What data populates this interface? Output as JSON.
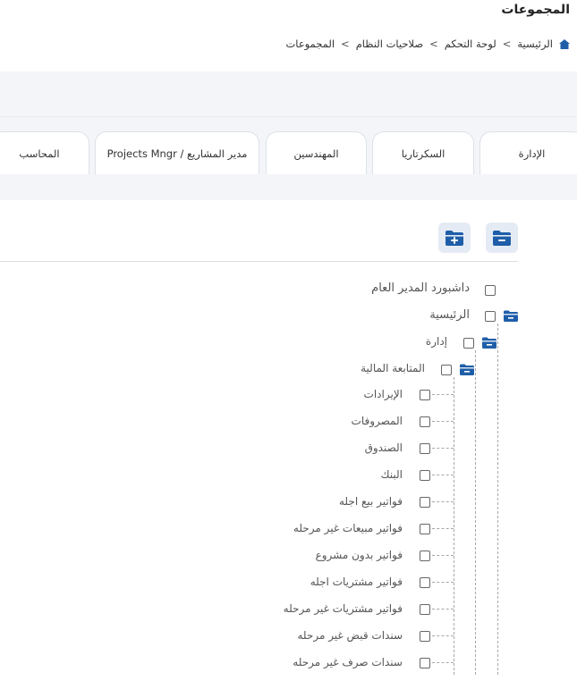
{
  "page": {
    "title": "المجموعات"
  },
  "breadcrumb": {
    "home_icon": "home-icon",
    "items": [
      "الرئيسية",
      "لوحة التحكم",
      "صلاحيات النظام",
      "المجموعات"
    ],
    "separator": ">"
  },
  "tabs": [
    {
      "label": "الإدارة"
    },
    {
      "label": "السكرتاريا"
    },
    {
      "label": "المهندسين"
    },
    {
      "label": "مدير المشاريع / Projects Mngr"
    },
    {
      "label": "المحاسب"
    }
  ],
  "toolbar": {
    "collapse_all_icon": "folder-minus-icon",
    "expand_all_icon": "folder-plus-icon"
  },
  "tree": {
    "root": [
      {
        "label": "داشبورد المدير العام"
      },
      {
        "label": "الرئيسية"
      }
    ],
    "level1": {
      "label": "إدارة"
    },
    "level2": {
      "label": "المتابعة المالية"
    },
    "leaves": [
      {
        "label": "الإيرادات"
      },
      {
        "label": "المصروفات"
      },
      {
        "label": "الصندوق"
      },
      {
        "label": "البنك"
      },
      {
        "label": "فواتير بيع اجله"
      },
      {
        "label": "فواتير مبيعات غير مرحله"
      },
      {
        "label": "فواتير بدون مشروع"
      },
      {
        "label": "فواتير مشتريات اجله"
      },
      {
        "label": "فواتير مشتريات غير مرحله"
      },
      {
        "label": "سندات قبض غير مرحله"
      },
      {
        "label": "سندات صرف غير مرحله"
      }
    ]
  },
  "colors": {
    "accent": "#1e5ea8",
    "band": "#f3f5f9",
    "tab_border": "#dde1e8",
    "button_bg": "#e5ebf4"
  }
}
